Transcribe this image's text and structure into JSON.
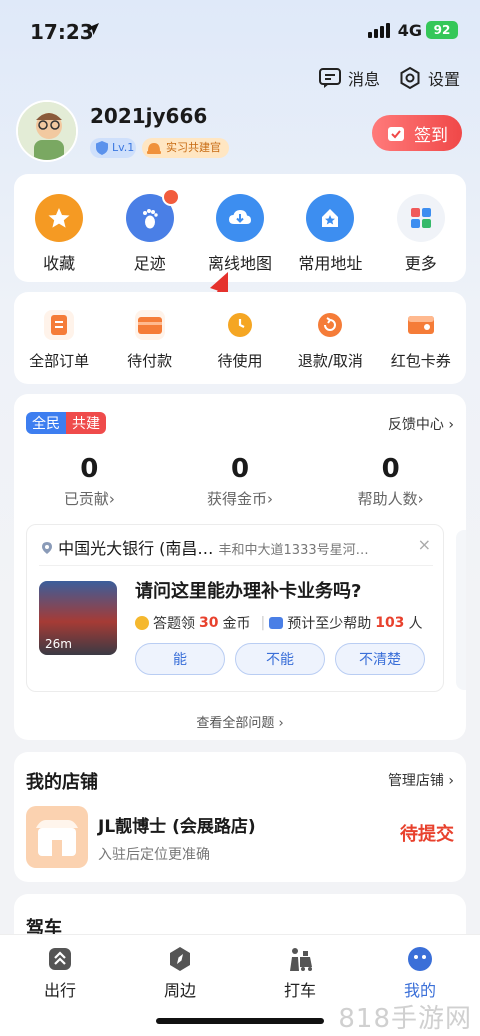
{
  "status_bar": {
    "time": "17:23",
    "network": "4G",
    "battery": "92"
  },
  "header": {
    "messages_label": "消息",
    "settings_label": "设置"
  },
  "profile": {
    "username": "2021jy666",
    "level_badge": "Lv.1",
    "role_badge": "实习共建官",
    "signin_label": "签到"
  },
  "quick_actions": [
    {
      "label": "收藏",
      "icon": "star-icon",
      "color": "#f59a23"
    },
    {
      "label": "足迹",
      "icon": "footprint-icon",
      "color": "#4a7fe6"
    },
    {
      "label": "离线地图",
      "icon": "cloud-download-icon",
      "color": "#3d8ef0"
    },
    {
      "label": "常用地址",
      "icon": "home-icon",
      "color": "#3d8ef0"
    },
    {
      "label": "更多",
      "icon": "grid-icon",
      "color": "#f0f3f8"
    }
  ],
  "orders": [
    {
      "label": "全部订单",
      "icon": "order-icon",
      "color": "#f57c38"
    },
    {
      "label": "待付款",
      "icon": "wallet-icon",
      "color": "#f57c38"
    },
    {
      "label": "待使用",
      "icon": "clock-icon",
      "color": "#f5a623"
    },
    {
      "label": "退款/取消",
      "icon": "refund-icon",
      "color": "#f57c38"
    },
    {
      "label": "红包卡券",
      "icon": "coupon-icon",
      "color": "#f57c38"
    }
  ],
  "co_build": {
    "tag_left": "全民",
    "tag_right": "共建",
    "feedback_link": "反馈中心 ›",
    "stats": [
      {
        "value": "0",
        "label": "已贡献›"
      },
      {
        "value": "0",
        "label": "获得金币›"
      },
      {
        "value": "0",
        "label": "帮助人数›"
      }
    ],
    "question_card": {
      "place_name": "中国光大银行 (南昌…",
      "place_address": "丰和中大道1333号星河…",
      "close_symbol": "×",
      "distance": "26m",
      "question": "请问这里能办理补卡业务吗?",
      "reward_prefix": "答题领",
      "reward_amount": "30",
      "reward_unit": "金币",
      "help_prefix": "预计至少帮助",
      "help_count": "103",
      "help_unit": "人",
      "answers": [
        "能",
        "不能",
        "不清楚"
      ]
    },
    "see_all": "查看全部问题 ›"
  },
  "shop": {
    "title": "我的店铺",
    "manage_link": "管理店铺 ›",
    "name": "JL靓博士 (会展路店)",
    "hint": "入驻后定位更准确",
    "status": "待提交"
  },
  "drive": {
    "title": "驾车"
  },
  "tabbar": [
    {
      "label": "出行",
      "icon": "travel-icon",
      "active": false
    },
    {
      "label": "周边",
      "icon": "compass-icon",
      "active": false
    },
    {
      "label": "打车",
      "icon": "taxi-icon",
      "active": false
    },
    {
      "label": "我的",
      "icon": "profile-face-icon",
      "active": true
    }
  ],
  "watermark": "818手游网"
}
